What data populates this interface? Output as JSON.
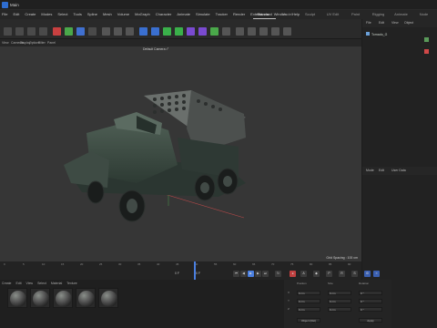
{
  "window": {
    "title": "Main"
  },
  "menu": [
    "File",
    "Edit",
    "Create",
    "Modes",
    "Select",
    "Tools",
    "Spline",
    "Mesh",
    "Volume",
    "MoGraph",
    "Character",
    "Animate",
    "Simulate",
    "Tracker",
    "Render",
    "Extensions",
    "Window",
    "Help"
  ],
  "layouts": [
    "Standard",
    "Model",
    "Sculpt",
    "UV Edit",
    "Paint",
    "Rigging",
    "Animate",
    "Node"
  ],
  "active_layout": "Standard",
  "viewport": {
    "menu": [
      "View",
      "Cameras",
      "Display",
      "Options",
      "Filter",
      "Panel"
    ],
    "camera_label": "Default Camera •°",
    "grid_spacing": "Grid Spacing : 100 cm"
  },
  "object_manager": {
    "menu": [
      "File",
      "Edit",
      "View",
      "Object"
    ],
    "object": "Tornado_G"
  },
  "attribute_manager": {
    "menu": [
      "Mode",
      "Edit",
      "User Data"
    ]
  },
  "timeline": {
    "ticks": [
      "0",
      "5",
      "10",
      "15",
      "20",
      "25",
      "30",
      "35",
      "40",
      "45",
      "50",
      "55",
      "60",
      "65",
      "70",
      "75",
      "80",
      "85",
      "90"
    ],
    "current_frame": "0 F",
    "start": "0 F",
    "end": "90 F"
  },
  "material_manager": {
    "menu": [
      "Create",
      "Edit",
      "View",
      "Select",
      "Material",
      "Texture"
    ],
    "count": 5
  },
  "coordinates": {
    "headers": [
      "Position",
      "Size",
      "Rotation"
    ],
    "rows": [
      {
        "axis": "X",
        "values": [
          "0 cm",
          "0 cm",
          "0 °"
        ]
      },
      {
        "axis": "Y",
        "values": [
          "0 cm",
          "0 cm",
          "0 °"
        ]
      },
      {
        "axis": "Z",
        "values": [
          "0 cm",
          "0 cm",
          "0 °"
        ]
      }
    ],
    "mode": "Object (Rel)",
    "apply": "Apply"
  }
}
